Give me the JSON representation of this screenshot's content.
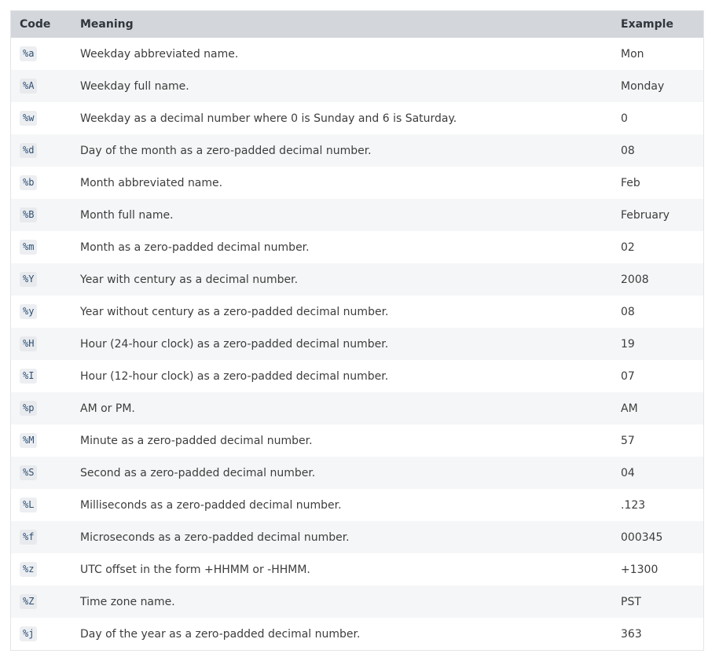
{
  "header": {
    "code": "Code",
    "meaning": "Meaning",
    "example": "Example"
  },
  "rows": [
    {
      "code": "%a",
      "meaning": "Weekday abbreviated name.",
      "example": "Mon"
    },
    {
      "code": "%A",
      "meaning": "Weekday full name.",
      "example": "Monday"
    },
    {
      "code": "%w",
      "meaning": "Weekday as a decimal number where 0 is Sunday and 6 is Saturday.",
      "example": "0"
    },
    {
      "code": "%d",
      "meaning": "Day of the month as a zero-padded decimal number.",
      "example": "08"
    },
    {
      "code": "%b",
      "meaning": "Month abbreviated name.",
      "example": "Feb"
    },
    {
      "code": "%B",
      "meaning": "Month full name.",
      "example": "February"
    },
    {
      "code": "%m",
      "meaning": "Month as a zero-padded decimal number.",
      "example": "02"
    },
    {
      "code": "%Y",
      "meaning": "Year with century as a decimal number.",
      "example": "2008"
    },
    {
      "code": "%y",
      "meaning": "Year without century as a zero-padded decimal number.",
      "example": "08"
    },
    {
      "code": "%H",
      "meaning": "Hour (24-hour clock) as a zero-padded decimal number.",
      "example": "19"
    },
    {
      "code": "%I",
      "meaning": "Hour (12-hour clock) as a zero-padded decimal number.",
      "example": "07"
    },
    {
      "code": "%p",
      "meaning": "AM or PM.",
      "example": "AM"
    },
    {
      "code": "%M",
      "meaning": "Minute as a zero-padded decimal number.",
      "example": "57"
    },
    {
      "code": "%S",
      "meaning": "Second as a zero-padded decimal number.",
      "example": "04"
    },
    {
      "code": "%L",
      "meaning": "Milliseconds as a zero-padded decimal number.",
      "example": ".123"
    },
    {
      "code": "%f",
      "meaning": "Microseconds as a zero-padded decimal number.",
      "example": "000345"
    },
    {
      "code": "%z",
      "meaning": "UTC offset in the form +HHMM or -HHMM.",
      "example": "+1300"
    },
    {
      "code": "%Z",
      "meaning": "Time zone name.",
      "example": "PST"
    },
    {
      "code": "%j",
      "meaning": "Day of the year as a zero-padded decimal number.",
      "example": "363"
    }
  ]
}
